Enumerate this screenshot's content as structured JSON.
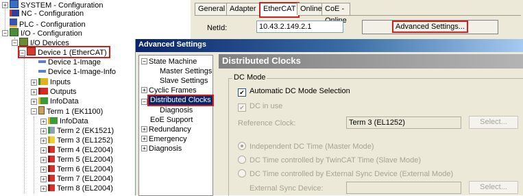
{
  "tree": {
    "items": [
      {
        "label": "SYSTEM - Configuration"
      },
      {
        "label": "NC - Configuration"
      },
      {
        "label": "PLC - Configuration"
      },
      {
        "label": "I/O - Configuration"
      },
      {
        "label": "I/O Devices"
      },
      {
        "label": "Device 1 (EtherCAT)"
      },
      {
        "label": "Device 1-Image"
      },
      {
        "label": "Device 1-Image-Info"
      },
      {
        "label": "Inputs"
      },
      {
        "label": "Outputs"
      },
      {
        "label": "InfoData"
      },
      {
        "label": "Term 1 (EK1100)"
      },
      {
        "label": "InfoData"
      },
      {
        "label": "Term 2 (EK1521)"
      },
      {
        "label": "Term 3 (EL1252)"
      },
      {
        "label": "Term 4 (EL2004)"
      },
      {
        "label": "Term 5 (EL2004)"
      },
      {
        "label": "Term 6 (EL2004)"
      },
      {
        "label": "Term 7 (EL2004)"
      },
      {
        "label": "Term 8 (EL2004)"
      }
    ]
  },
  "tabs": [
    "General",
    "Adapter",
    "EtherCAT",
    "Online",
    "CoE - Online"
  ],
  "ethercat": {
    "netid_label": "NetId:",
    "netid_value": "10.43.2.149.2.1",
    "advanced_button": "Advanced Settings..."
  },
  "dialog": {
    "title": "Advanced Settings",
    "nav": [
      {
        "label": "State Machine"
      },
      {
        "label": "Master Settings"
      },
      {
        "label": "Slave Settings"
      },
      {
        "label": "Cyclic Frames"
      },
      {
        "label": "Distributed Clocks"
      },
      {
        "label": "Diagnosis"
      },
      {
        "label": "EoE Support"
      },
      {
        "label": "Redundancy"
      },
      {
        "label": "Emergency"
      },
      {
        "label": "Diagnosis"
      }
    ],
    "panel_title": "Distributed Clocks",
    "group_label": "DC Mode",
    "auto_dc_label": "Automatic DC Mode Selection",
    "dc_in_use_label": "DC in use",
    "reference_clock_label": "Reference Clock:",
    "reference_clock_value": "Term 3 (EL1252)",
    "select_label": "Select...",
    "radio_independent": "Independent DC Time (Master Mode)",
    "radio_twincat": "DC Time controlled by TwinCAT Time (Slave Mode)",
    "radio_external": "DC Time controlled by External Sync Device (External Mode)",
    "external_sync_label": "External Sync Device:",
    "external_sync_value": ""
  },
  "colors": {
    "highlight": "#d21e1e",
    "titlebar": "#0a246a",
    "selection": "#0a246a"
  }
}
